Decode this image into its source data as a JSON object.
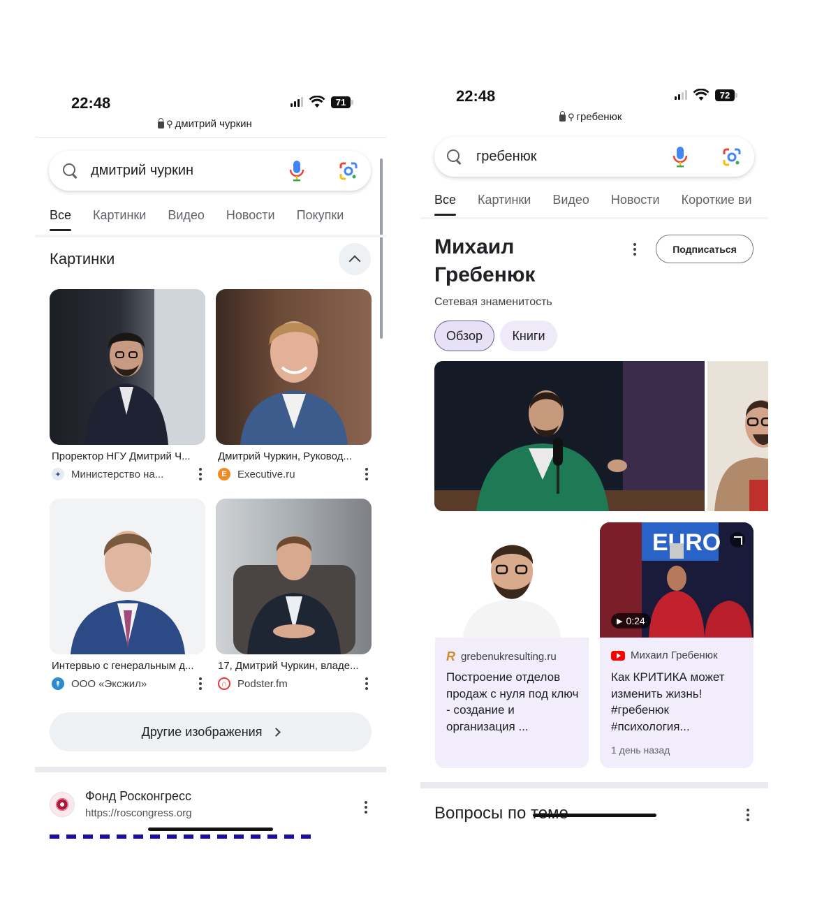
{
  "left": {
    "status": {
      "time": "22:48",
      "battery": "71"
    },
    "url": "дмитрий чуркин",
    "search": {
      "query": "дмитрий чуркин"
    },
    "tabs": [
      "Все",
      "Картинки",
      "Видео",
      "Новости",
      "Покупки"
    ],
    "images_section": {
      "title": "Картинки",
      "cards": [
        {
          "caption": "Проректор НГУ Дмитрий Ч...",
          "source": "Министерство на...",
          "icon": "emblem-icon"
        },
        {
          "caption": "Дмитрий Чуркин, Руковод...",
          "source": "Executive.ru",
          "icon": "executive-e-icon"
        },
        {
          "caption": "Интервью с генеральным д...",
          "source": "ООО «Эксжил»",
          "icon": "exgil-logo-icon"
        },
        {
          "caption": "17, Дмитрий Чуркин, владе...",
          "source": "Podster.fm",
          "icon": "headphones-icon"
        }
      ],
      "more_button": "Другие изображения"
    },
    "result": {
      "site": "Фонд Росконгресс",
      "url": "https://roscongress.org"
    }
  },
  "right": {
    "status": {
      "time": "22:48",
      "battery": "72"
    },
    "url": "гребенюк",
    "search": {
      "query": "гребенюк"
    },
    "tabs": [
      "Все",
      "Картинки",
      "Видео",
      "Новости",
      "Короткие ви"
    ],
    "knowledge_panel": {
      "name_line1": "Михаил",
      "name_line2": "Гребенюк",
      "subtitle": "Сетевая знаменитость",
      "subscribe": "Подписаться",
      "chips": [
        "Обзор",
        "Книги"
      ]
    },
    "cards": [
      {
        "source": "grebenukresulting.ru",
        "title": "Построение отделов продаж с нуля под ключ - создание и организация ..."
      },
      {
        "source": "Михаил Гребенюк",
        "title": "Как КРИТИКА может изменить жизнь! #гребенюк #психология...",
        "date": "1 день назад",
        "duration": "0:24"
      }
    ],
    "related_title": "Вопросы по теме"
  },
  "colors": {
    "accent_purple": "#e7e1f5",
    "chip_border": "#6a5b93",
    "card_bg": "#f1edfa",
    "divider": "#e8eaed"
  }
}
